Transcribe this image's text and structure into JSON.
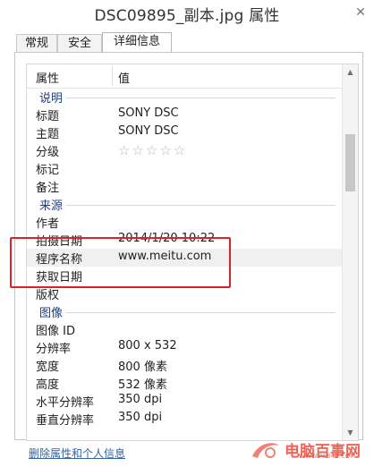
{
  "window": {
    "title": "DSC09895_副本.jpg 属性",
    "close_glyph": "✕"
  },
  "tabs": [
    {
      "label": "常规"
    },
    {
      "label": "安全"
    },
    {
      "label": "详细信息",
      "active": true
    }
  ],
  "list": {
    "col_property": "属性",
    "col_value": "值",
    "sections": [
      {
        "title": "说明",
        "rows": [
          {
            "key": "标题",
            "value": "SONY DSC"
          },
          {
            "key": "主题",
            "value": "SONY DSC"
          },
          {
            "key": "分级",
            "value": "",
            "rating": 0,
            "max": 5
          },
          {
            "key": "标记",
            "value": ""
          },
          {
            "key": "备注",
            "value": ""
          }
        ]
      },
      {
        "title": "来源",
        "rows": [
          {
            "key": "作者",
            "value": ""
          },
          {
            "key": "拍摄日期",
            "value": "2014/1/20 10:22"
          },
          {
            "key": "程序名称",
            "value": "www.meitu.com"
          },
          {
            "key": "获取日期",
            "value": ""
          },
          {
            "key": "版权",
            "value": ""
          }
        ]
      },
      {
        "title": "图像",
        "rows": [
          {
            "key": "图像 ID",
            "value": ""
          },
          {
            "key": "分辨率",
            "value": "800 x 532"
          },
          {
            "key": "宽度",
            "value": "800 像素"
          },
          {
            "key": "高度",
            "value": "532 像素"
          },
          {
            "key": "水平分辨率",
            "value": "350 dpi"
          },
          {
            "key": "垂直分辨率",
            "value": "350 dpi"
          }
        ]
      }
    ]
  },
  "footer_link": "删除属性和个人信息",
  "watermark": {
    "text": "电脑百事网",
    "url": "WWW.PC841.COM"
  },
  "colors": {
    "highlight_box": "#d9232a",
    "section_title": "#1e3e84",
    "link": "#2f64ac"
  }
}
